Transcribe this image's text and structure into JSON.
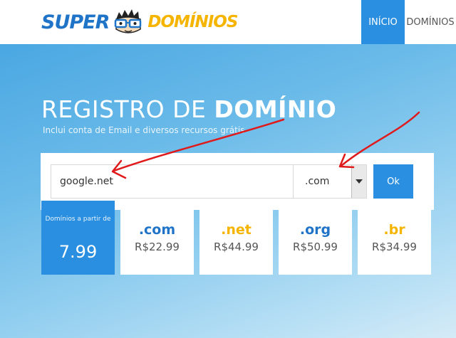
{
  "brand": {
    "logo_super": "SUPER",
    "logo_dominios": "DOMÍNIOS"
  },
  "nav": {
    "items": [
      {
        "label": "INÍCIO",
        "active": true
      },
      {
        "label": "DOMÍNIOS",
        "active": false
      }
    ]
  },
  "hero": {
    "title_light": "REGISTRO DE ",
    "title_bold": "DOMÍNIO",
    "subtitle": "Inclui conta de Email e diversos recursos grátis"
  },
  "search": {
    "input_value": "google.net",
    "tld_selected": ".com",
    "ok_label": "Ok"
  },
  "pricing": {
    "intro_label": "Domínios a partir de",
    "intro_value": "7.99",
    "cards": [
      {
        "tld": ".com",
        "price": "R$22.99",
        "color": "#1f74c8"
      },
      {
        "tld": ".net",
        "price": "R$44.99",
        "color": "#f5b400"
      },
      {
        "tld": ".org",
        "price": "R$50.99",
        "color": "#1f74c8"
      },
      {
        "tld": ".br",
        "price": "R$34.99",
        "color": "#f5b400"
      }
    ]
  },
  "colors": {
    "brand_blue": "#1f74c8",
    "accent_blue": "#2a8fe0",
    "brand_yellow": "#f5b400",
    "annotation_red": "#e0191b"
  }
}
